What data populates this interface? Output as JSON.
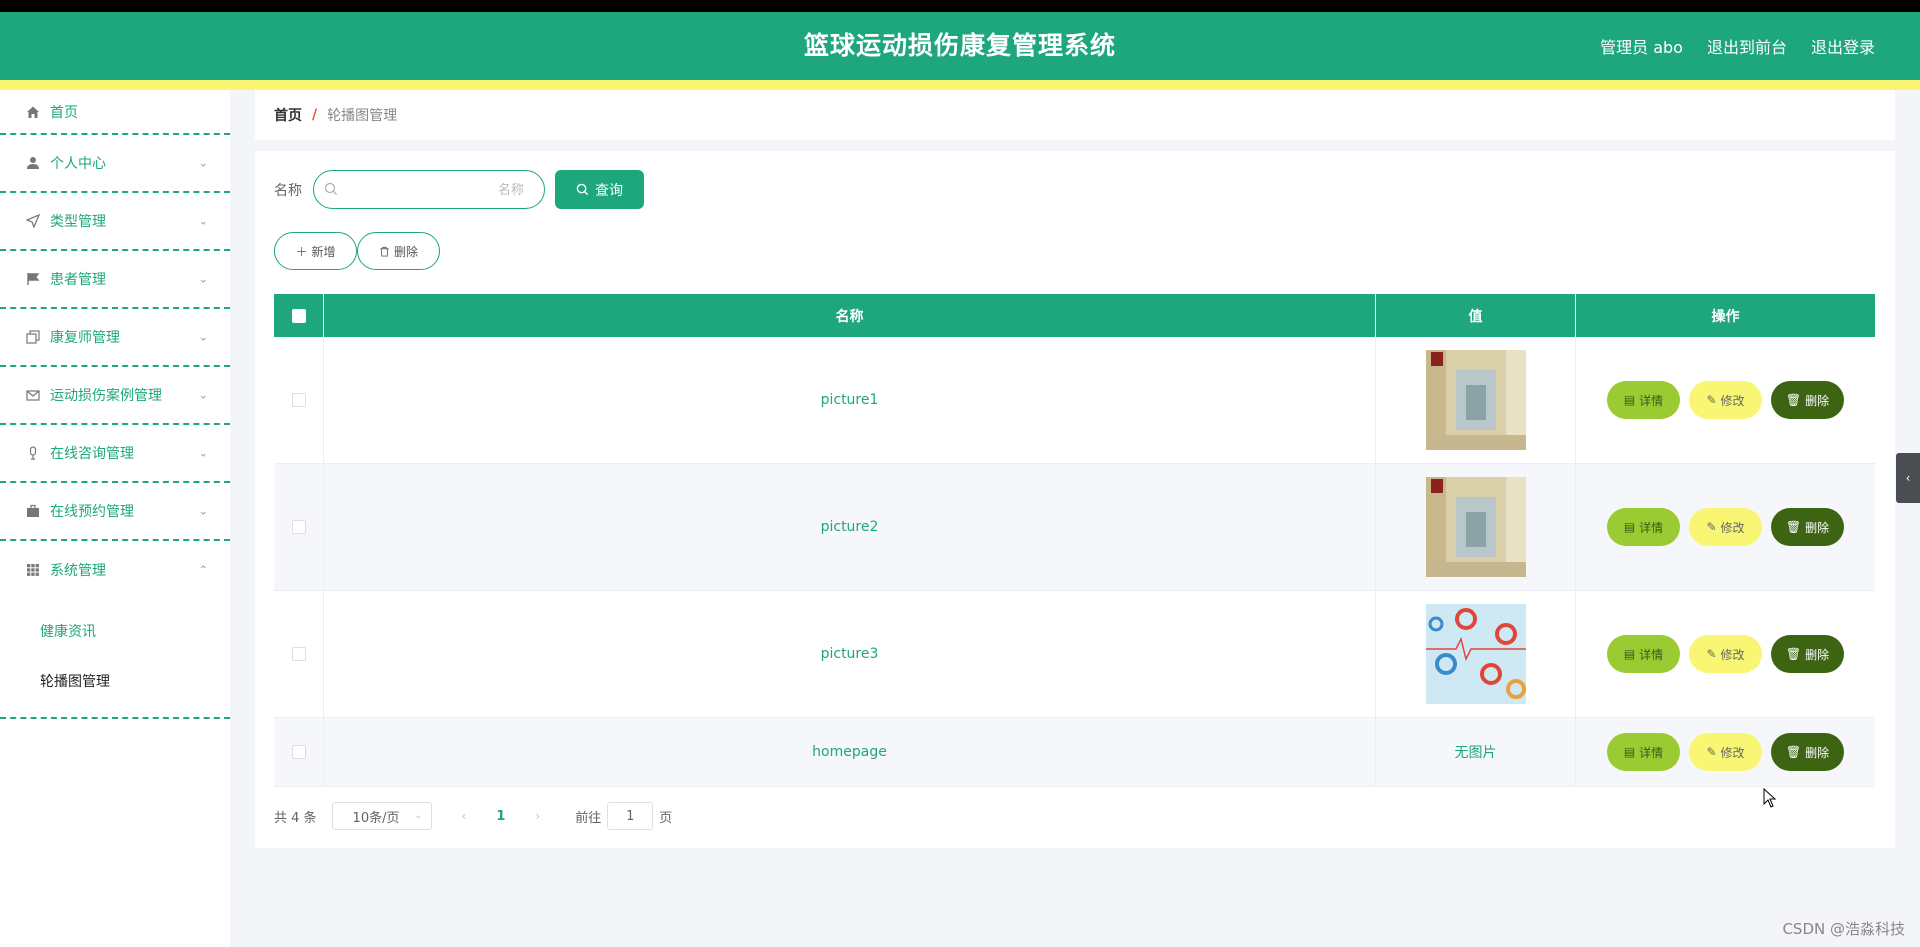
{
  "header": {
    "title": "篮球运动损伤康复管理系统",
    "user_label": "管理员 abo",
    "front_link": "退出到前台",
    "logout_link": "退出登录"
  },
  "sidebar": {
    "items": [
      {
        "label": "首页",
        "icon": "home-icon"
      },
      {
        "label": "个人中心",
        "icon": "user-icon"
      },
      {
        "label": "类型管理",
        "icon": "send-icon"
      },
      {
        "label": "患者管理",
        "icon": "flag-icon"
      },
      {
        "label": "康复师管理",
        "icon": "copy-icon"
      },
      {
        "label": "运动损伤案例管理",
        "icon": "mail-icon"
      },
      {
        "label": "在线咨询管理",
        "icon": "microphone-icon"
      },
      {
        "label": "在线预约管理",
        "icon": "suitcase-icon"
      },
      {
        "label": "系统管理",
        "icon": "grid-icon"
      }
    ],
    "sub_items": [
      "健康资讯",
      "轮播图管理"
    ]
  },
  "breadcrumb": {
    "home": "首页",
    "separator": "/",
    "current": "轮播图管理"
  },
  "search": {
    "label": "名称",
    "placeholder": "名称",
    "button": "查询"
  },
  "actions": {
    "add": "新增",
    "delete": "删除"
  },
  "table": {
    "headers": [
      "名称",
      "值",
      "操作"
    ],
    "rows": [
      {
        "name": "picture1",
        "value": "image",
        "thumb": "corridor"
      },
      {
        "name": "picture2",
        "value": "image",
        "thumb": "corridor"
      },
      {
        "name": "picture3",
        "value": "image",
        "thumb": "medical"
      },
      {
        "name": "homepage",
        "value": "无图片",
        "thumb": ""
      }
    ],
    "op_labels": {
      "detail": "详情",
      "edit": "修改",
      "delete": "删除"
    }
  },
  "pagination": {
    "total": "共 4 条",
    "page_size": "10条/页",
    "current": "1",
    "goto_label": "前往",
    "goto_value": "1",
    "unit": "页"
  },
  "watermark": "CSDN @浩淼科技",
  "colors": {
    "primary": "#1ea67c",
    "accent_yellow": "#f8f673",
    "detail_green": "#9bcb33",
    "delete_dark": "#3c6413"
  }
}
